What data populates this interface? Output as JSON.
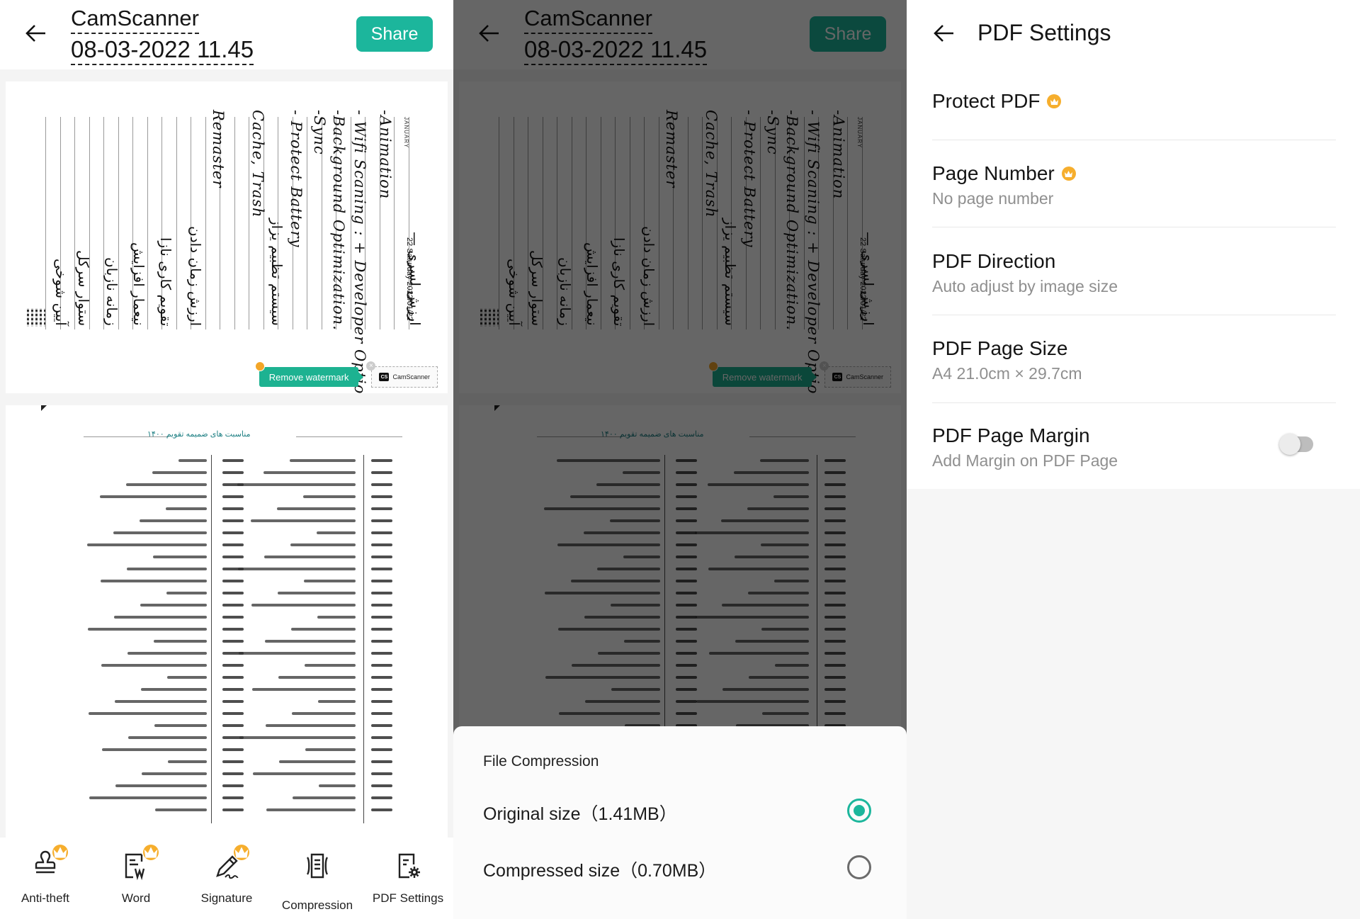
{
  "colors": {
    "accent": "#1cb69c",
    "crown": "#f6ae2d",
    "watermark": "#1db291"
  },
  "doc": {
    "title_line1": "CamScanner",
    "title_line2": "08-03-2022 11.45",
    "share_label": "Share",
    "back_icon": "arrow-left-icon"
  },
  "page1": {
    "type": "handwritten notebook page (rotated)",
    "month": "JANUARY",
    "date": "22 Saturday 2022/01/22",
    "lines": [
      "-Animation",
      "- Wifi Scaning : + Developer Options",
      "-Background Optimization.",
      "-Sync",
      "- Protect Battery",
      "Cache, Trash",
      "Remaster"
    ]
  },
  "watermark": {
    "remove_label": "Remove watermark",
    "badge_logo": "CS",
    "badge_label": "CamScanner"
  },
  "page2": {
    "type": "scanned Persian calendar table",
    "title": "مناسبت های ضمیمه تقویم ۱۴۰۰"
  },
  "toolbar": {
    "items": [
      {
        "label": "Anti-theft",
        "icon": "stamp-icon",
        "premium": true
      },
      {
        "label": "Word",
        "icon": "word-doc-icon",
        "premium": true
      },
      {
        "label": "Signature",
        "icon": "signature-pen-icon",
        "premium": true
      },
      {
        "label": "Compression",
        "icon": "compress-doc-icon",
        "premium": false
      },
      {
        "label": "PDF Settings",
        "icon": "doc-settings-icon",
        "premium": false
      }
    ]
  },
  "compression_sheet": {
    "title": "File Compression",
    "options": [
      {
        "label": "Original size（1.41MB）",
        "selected": true
      },
      {
        "label": "Compressed size（0.70MB）",
        "selected": false
      }
    ]
  },
  "pdf_settings": {
    "title": "PDF Settings",
    "items": [
      {
        "name": "Protect PDF",
        "sub": "",
        "premium": true
      },
      {
        "name": "Page Number",
        "sub": "No page number",
        "premium": true
      },
      {
        "name": "PDF Direction",
        "sub": "Auto adjust by image size",
        "premium": false
      },
      {
        "name": "PDF Page Size",
        "sub": "A4 21.0cm × 29.7cm",
        "premium": false
      },
      {
        "name": "PDF Page Margin",
        "sub": "Add Margin on PDF Page",
        "premium": false,
        "toggle": false
      }
    ]
  }
}
